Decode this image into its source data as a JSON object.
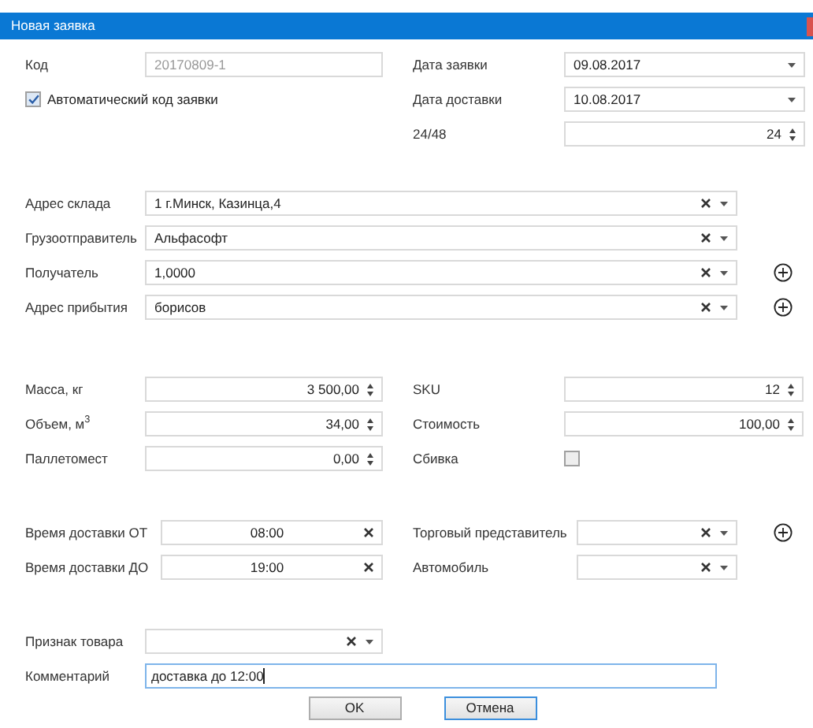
{
  "window": {
    "title": "Новая заявка"
  },
  "code": {
    "label": "Код",
    "value": "20170809-1",
    "disabled": true
  },
  "auto_code": {
    "label": "Автоматический код заявки",
    "checked": true
  },
  "header_right": [
    {
      "kind": "date",
      "label": "Дата заявки",
      "value": "09.08.2017"
    },
    {
      "kind": "date",
      "label": "Дата доставки",
      "value": "10.08.2017"
    },
    {
      "kind": "spin",
      "label": "24/48",
      "value": "24"
    }
  ],
  "addresses": [
    {
      "label": "Адрес склада",
      "value": "1 г.Минск, Казинца,4",
      "add_button": false
    },
    {
      "label": "Грузоотправитель",
      "value": "Альфасофт",
      "add_button": false
    },
    {
      "label": "Получатель",
      "value": "1,0000",
      "add_button": true
    },
    {
      "label": "Адрес прибытия",
      "value": "борисов",
      "add_button": true
    }
  ],
  "cargo_left": [
    {
      "kind": "spin",
      "label": "Масса, кг",
      "value": "3 500,00"
    },
    {
      "kind": "spin",
      "label": "Объем, м$^{3}$",
      "value": "34,00"
    },
    {
      "kind": "spin",
      "label": "Паллетомест",
      "value": "0,00"
    }
  ],
  "cargo_right": [
    {
      "kind": "spin",
      "label": "SKU",
      "value": "12"
    },
    {
      "kind": "spin",
      "label": "Стоимость",
      "value": "100,00"
    },
    {
      "kind": "checkbox",
      "label": "Сбивка",
      "checked": false
    }
  ],
  "time_left": [
    {
      "label": "Время доставки  ОТ",
      "value": "08:00"
    },
    {
      "label": "Время доставки ДО",
      "value": "19:00"
    }
  ],
  "time_right": [
    {
      "label": "Торговый представитель",
      "add_button": true
    },
    {
      "label": "Автомобиль",
      "add_button": false
    }
  ],
  "product_sign": {
    "label": "Признак товара"
  },
  "comment": {
    "label": "Комментарий",
    "value": "доставка до 12:00",
    "focused": true
  },
  "buttons": [
    {
      "label": "OK",
      "focused": false
    },
    {
      "label": "Отмена",
      "focused": true
    }
  ]
}
